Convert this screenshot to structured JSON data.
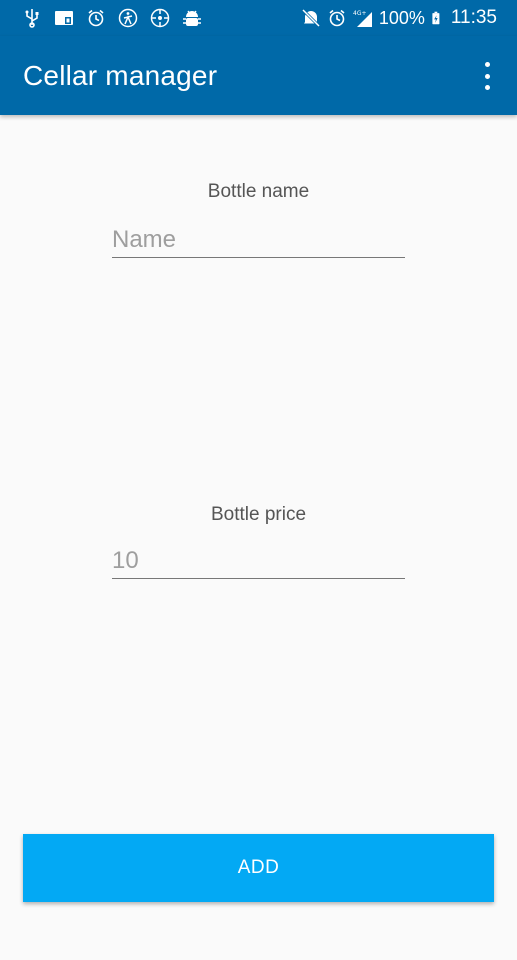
{
  "status_bar": {
    "left_icons": [
      "usb-icon",
      "screen-cast-icon",
      "alarm-icon",
      "accessibility-icon",
      "gps-icon",
      "android-debug-icon"
    ],
    "right_icons": [
      "mute-icon",
      "alarm-icon",
      "signal-4g-icon",
      "battery-charging-icon"
    ],
    "network_label": "4G+",
    "battery": "100%",
    "time": "11:35"
  },
  "app_bar": {
    "title": "Cellar manager",
    "menu_icon": "overflow-menu-icon"
  },
  "form": {
    "bottle_name": {
      "label": "Bottle name",
      "placeholder": "Name",
      "value": ""
    },
    "bottle_price": {
      "label": "Bottle price",
      "placeholder": "10",
      "value": ""
    }
  },
  "actions": {
    "add_label": "ADD"
  },
  "colors": {
    "app_bar": "#0069a8",
    "button": "#03a9f4",
    "background": "#fafafa"
  }
}
